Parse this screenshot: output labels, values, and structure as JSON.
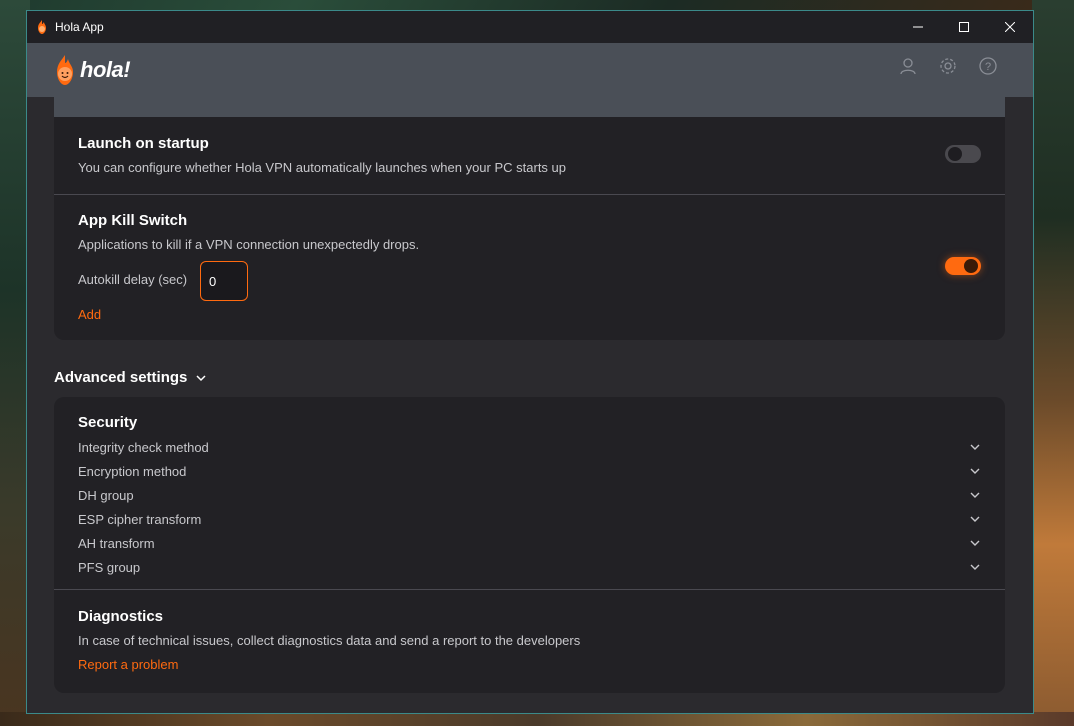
{
  "window": {
    "title": "Hola App",
    "controls": [
      "minimize-icon",
      "maximize-icon",
      "close-icon"
    ]
  },
  "header": {
    "logo_text": "hola!",
    "icons": [
      "user-icon",
      "gear-icon",
      "help-icon"
    ]
  },
  "launch_on_startup": {
    "title": "Launch on startup",
    "description": "You can configure whether Hola VPN automatically launches when your PC starts up",
    "enabled": false
  },
  "kill_switch": {
    "title": "App Kill Switch",
    "description": "Applications to kill if a VPN connection unexpectedly drops.",
    "delay_label": "Autokill delay (sec)",
    "delay_value": "0",
    "add_label": "Add",
    "enabled": true
  },
  "advanced": {
    "label": "Advanced settings"
  },
  "security": {
    "title": "Security",
    "items": [
      {
        "label": "Integrity check method"
      },
      {
        "label": "Encryption method"
      },
      {
        "label": "DH group"
      },
      {
        "label": "ESP cipher transform"
      },
      {
        "label": "AH transform"
      },
      {
        "label": "PFS group"
      }
    ]
  },
  "diagnostics": {
    "title": "Diagnostics",
    "description": "In case of technical issues, collect diagnostics data and send a report to the developers",
    "report_label": "Report a problem"
  },
  "colors": {
    "accent": "#ff6a10",
    "card": "#222125",
    "header": "#4a4f57"
  }
}
